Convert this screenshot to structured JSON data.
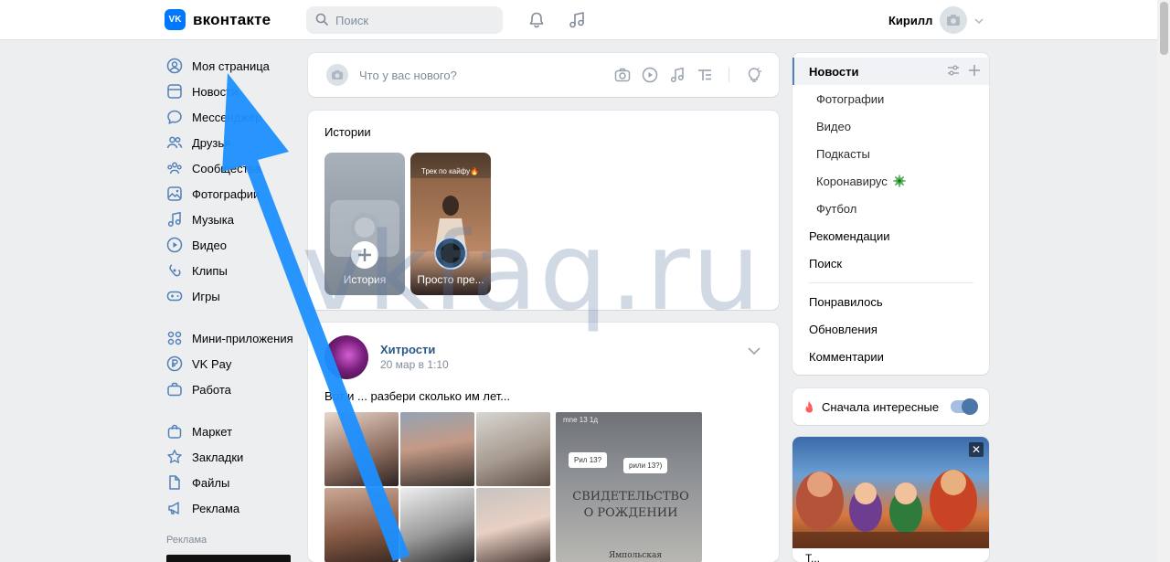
{
  "header": {
    "logo_text": "вконтакте",
    "logo_mark": "VK",
    "search_placeholder": "Поиск",
    "user_name": "Кирилл",
    "icons": [
      "bell-icon",
      "music-icon",
      "camera-icon",
      "chevron-down-icon"
    ]
  },
  "leftnav": {
    "items": [
      {
        "label": "Моя страница",
        "icon": "user-circle-icon"
      },
      {
        "label": "Новости",
        "icon": "newspaper-icon"
      },
      {
        "label": "Мессенджер",
        "icon": "message-icon"
      },
      {
        "label": "Друзья",
        "icon": "friends-icon"
      },
      {
        "label": "Сообщества",
        "icon": "community-icon"
      },
      {
        "label": "Фотографии",
        "icon": "photo-icon"
      },
      {
        "label": "Музыка",
        "icon": "music-icon"
      },
      {
        "label": "Видео",
        "icon": "video-icon"
      },
      {
        "label": "Клипы",
        "icon": "clips-icon"
      },
      {
        "label": "Игры",
        "icon": "gamepad-icon"
      }
    ],
    "items2": [
      {
        "label": "Мини-приложения",
        "icon": "apps-icon"
      },
      {
        "label": "VK Pay",
        "icon": "vkpay-icon"
      },
      {
        "label": "Работа",
        "icon": "briefcase-icon"
      }
    ],
    "items3": [
      {
        "label": "Маркет",
        "icon": "bag-icon"
      },
      {
        "label": "Закладки",
        "icon": "star-icon"
      },
      {
        "label": "Файлы",
        "icon": "file-icon"
      },
      {
        "label": "Реклама",
        "icon": "megaphone-icon"
      }
    ],
    "ads_label": "Реклама"
  },
  "composer": {
    "placeholder": "Что у вас нового?"
  },
  "stories": {
    "title": "Истории",
    "items": [
      {
        "caption": "История"
      },
      {
        "caption": "Просто пре...",
        "overlay_text": "Трек по кайфу🔥"
      }
    ]
  },
  "post": {
    "author": "Хитрости",
    "date": "20 мар в 1:10",
    "text": "Вот и ... разбери сколько им лет...",
    "image_text": {
      "header": "mne 13  1д",
      "note1": "Рил 13?",
      "note2": "рили 13?)",
      "cert": "СВИДЕТЕЛЬСТВО О РОЖДЕНИИ",
      "footer": "Ямпольская"
    }
  },
  "rightmenu": {
    "items": [
      {
        "label": "Новости",
        "kind": "active"
      },
      {
        "label": "Фотографии",
        "kind": "sub"
      },
      {
        "label": "Видео",
        "kind": "sub"
      },
      {
        "label": "Подкасты",
        "kind": "sub"
      },
      {
        "label": "Коронавирус",
        "kind": "sub"
      },
      {
        "label": "Футбол",
        "kind": "sub"
      },
      {
        "label": "Рекомендации",
        "kind": "top"
      },
      {
        "label": "Поиск",
        "kind": "top"
      },
      {
        "label": "Понравилось",
        "kind": "top"
      },
      {
        "label": "Обновления",
        "kind": "top"
      },
      {
        "label": "Комментарии",
        "kind": "top"
      }
    ]
  },
  "toggle": {
    "label": "Сначала интересные",
    "on": true
  },
  "ad": {
    "close": "✕",
    "title_partial": "Т..."
  },
  "watermark": "vkfaq.ru",
  "colors": {
    "accent": "#0077ff",
    "link": "#2a5885",
    "arrow": "#1e8fff",
    "background": "#edeef0"
  }
}
